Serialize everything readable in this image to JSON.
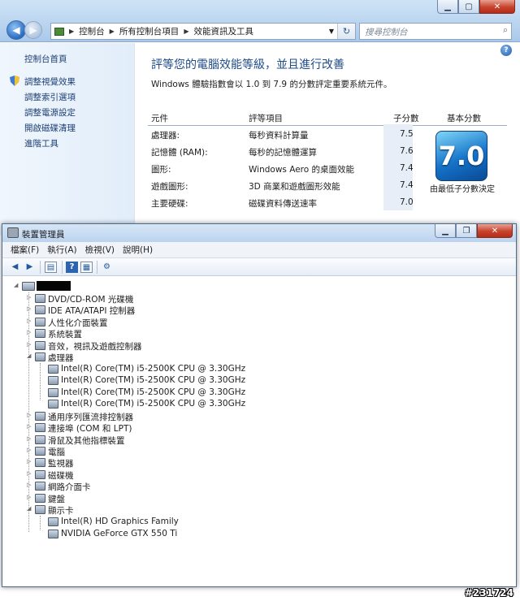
{
  "control_panel": {
    "breadcrumb": [
      "控制台",
      "所有控制台項目",
      "效能資訊及工具"
    ],
    "search_placeholder": "搜尋控制台",
    "sidebar": [
      "控制台首頁",
      "調整視覺效果",
      "調整索引選項",
      "調整電源設定",
      "開啟磁碟清理",
      "進階工具"
    ],
    "title": "評等您的電腦效能等級，並且進行改善",
    "subtitle": "Windows 體驗指數會以 1.0 到 7.9 的分數評定重要系統元件。",
    "columns": {
      "component": "元件",
      "rated": "評等項目",
      "subscore": "子分數",
      "base": "基本分數"
    },
    "rows": [
      {
        "component": "處理器:",
        "rated": "每秒資料計算量",
        "score": "7.5"
      },
      {
        "component": "記憶體 (RAM):",
        "rated": "每秒的記憶體運算",
        "score": "7.6"
      },
      {
        "component": "圖形:",
        "rated": "Windows Aero 的桌面效能",
        "score": "7.4"
      },
      {
        "component": "遊戲圖形:",
        "rated": "3D 商業和遊戲圖形效能",
        "score": "7.4"
      },
      {
        "component": "主要硬碟:",
        "rated": "磁碟資料傳送速率",
        "score": "7.0"
      }
    ],
    "base_score": "7.0",
    "base_desc": "由最低子分數決定"
  },
  "device_manager": {
    "title": "裝置管理員",
    "menu": [
      "檔案(F)",
      "執行(A)",
      "檢視(V)",
      "說明(H)"
    ],
    "categories": [
      "DVD/CD-ROM 光碟機",
      "IDE ATA/ATAPI 控制器",
      "人性化介面裝置",
      "系統裝置",
      "音效，視訊及遊戲控制器",
      "處理器",
      "通用序列匯流排控制器",
      "連接埠 (COM 和 LPT)",
      "滑鼠及其他指標裝置",
      "電腦",
      "監視器",
      "磁碟機",
      "網路介面卡",
      "鍵盤",
      "顯示卡"
    ],
    "processors": [
      "Intel(R) Core(TM) i5-2500K CPU @ 3.30GHz",
      "Intel(R) Core(TM) i5-2500K CPU @ 3.30GHz",
      "Intel(R) Core(TM) i5-2500K CPU @ 3.30GHz",
      "Intel(R) Core(TM) i5-2500K CPU @ 3.30GHz"
    ],
    "display_adapters": [
      "Intel(R)  HD Graphics Family",
      "NVIDIA GeForce GTX 550 Ti"
    ]
  },
  "watermark": "#231724"
}
